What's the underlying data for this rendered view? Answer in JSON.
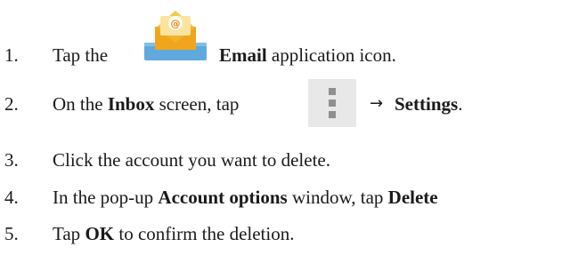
{
  "steps": [
    {
      "num": "1.",
      "pre": "Tap the",
      "bold": "Email",
      "post": "application icon."
    },
    {
      "num": "2.",
      "pre": "On the",
      "bold1": "Inbox",
      "mid": "screen, tap",
      "arrow": "→",
      "bold2": "Settings",
      "post": "."
    },
    {
      "num": "3.",
      "text": "Click the account you want to delete."
    },
    {
      "num": "4.",
      "pre": "In the pop-up",
      "bold1": "Account options",
      "mid": "window, tap",
      "bold2": "Delete"
    },
    {
      "num": "5.",
      "pre": "Tap",
      "bold": "OK",
      "post": "to confirm the deletion."
    }
  ],
  "icons": {
    "email_icon_badge": "@",
    "email_icon_name": "email-app-icon",
    "menu_icon_name": "overflow-menu-icon",
    "email_envelope_color": "#f3b229",
    "email_tray_color": "#5fa9dd"
  }
}
